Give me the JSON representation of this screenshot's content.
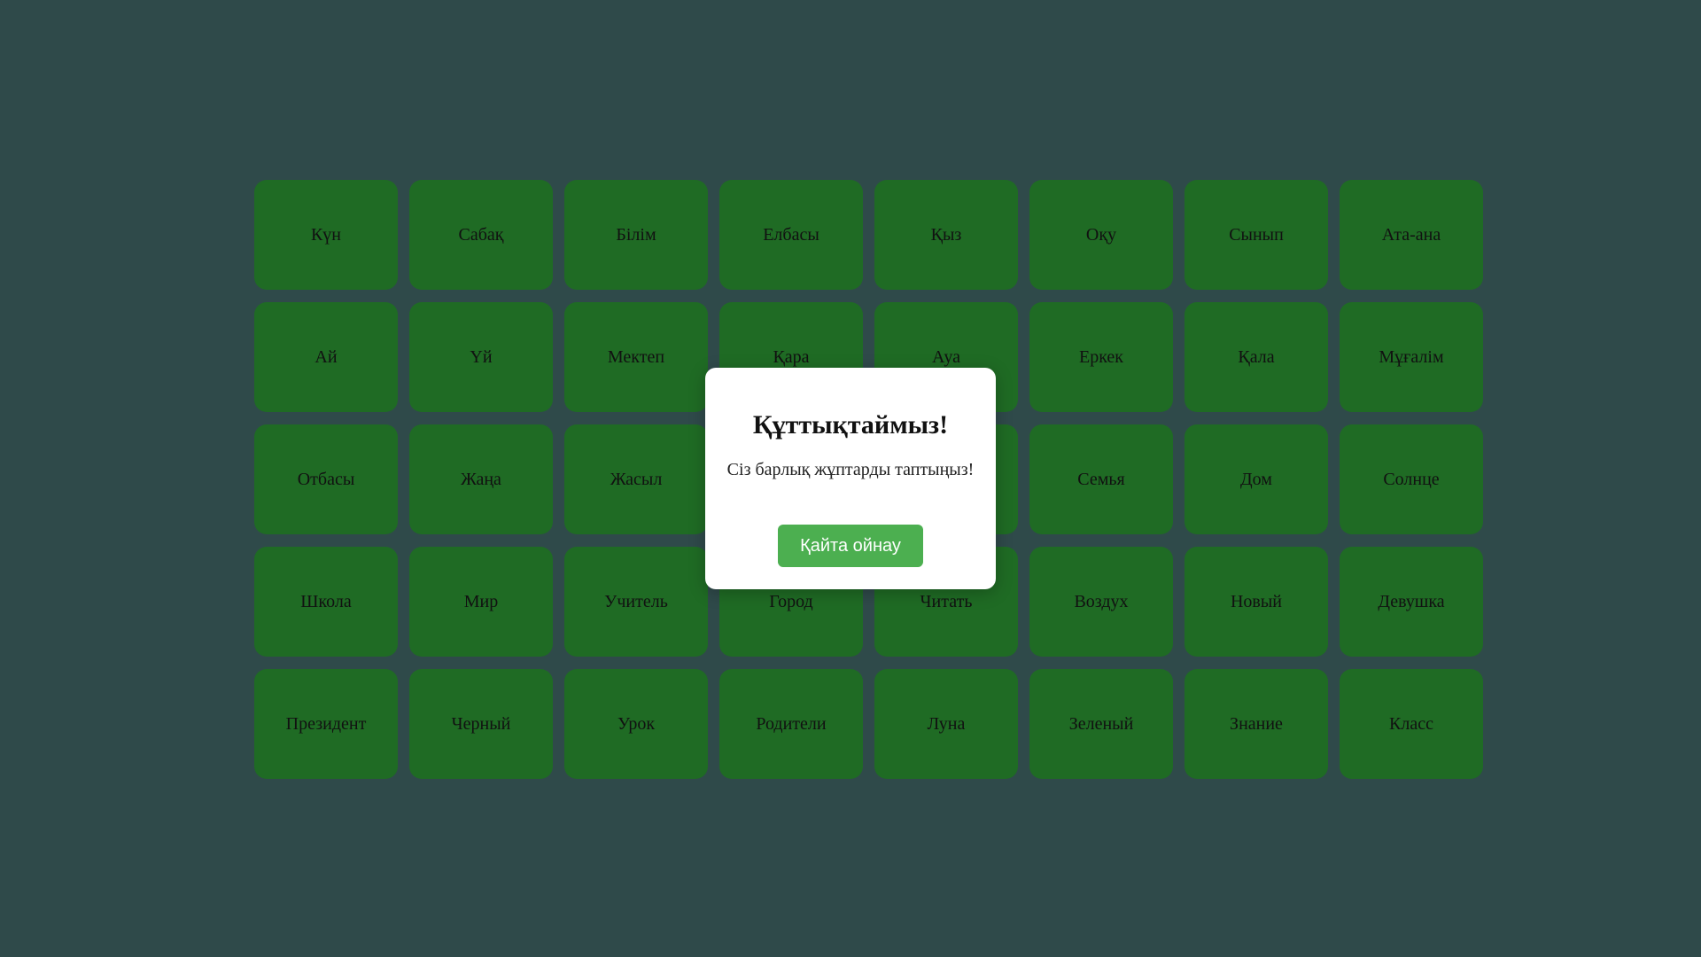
{
  "cards": [
    "Күн",
    "Сабақ",
    "Білім",
    "Елбасы",
    "Қыз",
    "Оқу",
    "Сынып",
    "Ата-ана",
    "Ай",
    "Үй",
    "Мектеп",
    "Қара",
    "Ауа",
    "Еркек",
    "Қала",
    "Мұғалім",
    "Отбасы",
    "Жаңа",
    "Жасыл",
    "",
    "",
    "Семья",
    "Дом",
    "Солнце",
    "Школа",
    "Мир",
    "Учитель",
    "Город",
    "Читать",
    "Воздух",
    "Новый",
    "Девушка",
    "Президент",
    "Черный",
    "Урок",
    "Родители",
    "Луна",
    "Зеленый",
    "Знание",
    "Класс"
  ],
  "modal": {
    "title": "Құттықтаймыз!",
    "message": "Сіз барлық жұптарды таптыңыз!",
    "button_label": "Қайта ойнау"
  },
  "colors": {
    "background": "#2f4a4a",
    "card": "#1f6b24",
    "button": "#4caf50"
  }
}
